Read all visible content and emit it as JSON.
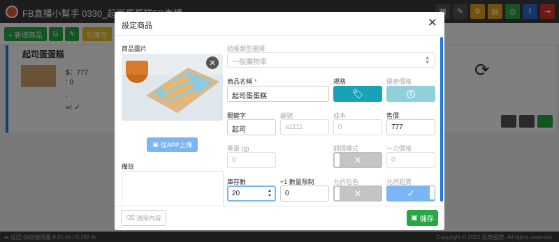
{
  "app": {
    "title": "FB直播小幫手  0330_起司蛋蛋糕FB直播",
    "toolbar_add": "+ 新增商品",
    "toolbar_extra": "從庫存"
  },
  "background_card": {
    "name": "起司蛋蛋糕",
    "price_line": "$：777",
    "count_line": ": 0",
    "comment_line": ":",
    "inf_line": "∞: ✓"
  },
  "footer_bar": {
    "left": "⬅ 返回    快取使用量 9.81 kb / 0.192 %",
    "right": "Copyright © 2023 玩樂國際. All rights reserved."
  },
  "modal": {
    "title": "設定商品",
    "close_icon": "close-icon",
    "image_label": "商品圖片",
    "upload_label": "從APP上傳",
    "remark_label": "備註",
    "checkout_type_label": "結帳類型選擇",
    "checkout_type_value": "一般購物車",
    "name_label": "商品名稱",
    "name_value": "起司蛋蛋糕",
    "spec_label": "規格",
    "discount_label": "優惠價格",
    "keyword_label": "關鍵字",
    "keyword_value": "起司",
    "code_label": "編號",
    "code_placeholder": "a1111",
    "cost_label": "成本",
    "cost_placeholder": "0",
    "price_label": "售價",
    "price_value": "777",
    "weight_label": "重量 (g)",
    "weight_placeholder": "0",
    "amount_mode_label": "額價模式",
    "onecut_label": "一刀價格",
    "onecut_placeholder": "0",
    "stock_label": "庫存數",
    "stock_value": "20",
    "limit_label": "+1 數量限制",
    "limit_value": "0",
    "allow_wrap_label": "允許包色",
    "allow_oversell_label": "允許超賣",
    "clear_label": "清除內容",
    "save_label": "儲存"
  },
  "colors": {
    "teal": "#18a2b8",
    "save_green": "#28a745",
    "upload_blue": "#7cb5f5",
    "required_red": "#e03b3b"
  }
}
